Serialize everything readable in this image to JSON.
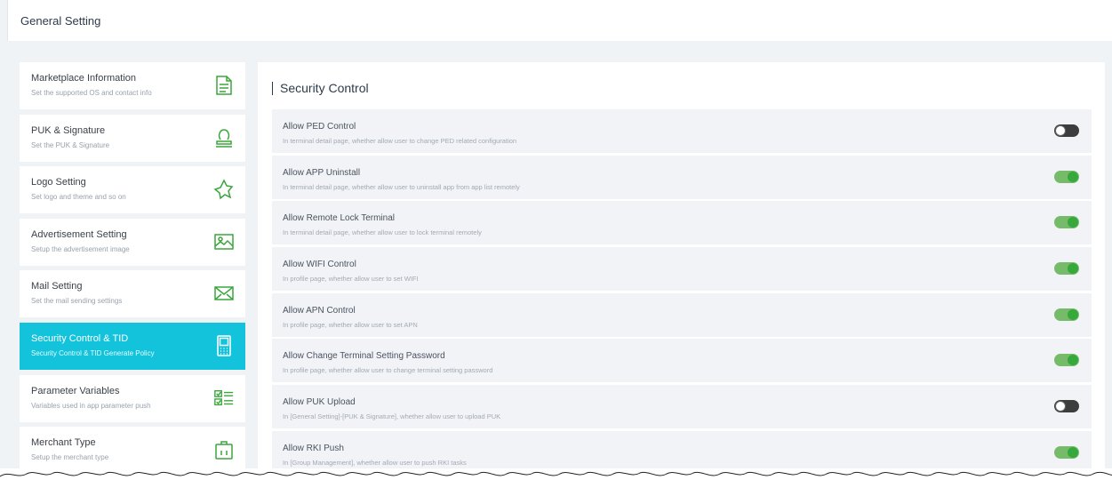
{
  "header": {
    "title": "General Setting"
  },
  "sidebar": {
    "items": [
      {
        "label": "Marketplace Information",
        "desc": "Set the supported OS and contact info",
        "icon": "document-icon"
      },
      {
        "label": "PUK & Signature",
        "desc": "Set the PUK & Signature",
        "icon": "stamp-icon"
      },
      {
        "label": "Logo Setting",
        "desc": "Set logo and theme and so on",
        "icon": "star-badge-icon"
      },
      {
        "label": "Advertisement Setting",
        "desc": "Setup the advertisement image",
        "icon": "image-icon"
      },
      {
        "label": "Mail Setting",
        "desc": "Set the mail sending settings",
        "icon": "mail-icon"
      },
      {
        "label": "Security Control & TID",
        "desc": "Security Control & TID Generate Policy",
        "icon": "terminal-icon",
        "active": true
      },
      {
        "label": "Parameter Variables",
        "desc": "Variables used in app parameter push",
        "icon": "checklist-icon"
      },
      {
        "label": "Merchant Type",
        "desc": "Setup the merchant type",
        "icon": "briefcase-icon"
      }
    ]
  },
  "main": {
    "section_title": "Security Control",
    "rows": [
      {
        "label": "Allow PED Control",
        "desc": "In terminal detail page, whether allow user to change PED related configuration",
        "enabled": false
      },
      {
        "label": "Allow APP Uninstall",
        "desc": "In terminal detail page, whether allow user to uninstall app from app list remotely",
        "enabled": true
      },
      {
        "label": "Allow Remote Lock Terminal",
        "desc": "In terminal detail page, whether allow user to lock terminal remotely",
        "enabled": true
      },
      {
        "label": "Allow WIFI Control",
        "desc": "In profile page, whether allow user to set WIFI",
        "enabled": true
      },
      {
        "label": "Allow APN Control",
        "desc": "In profile page, whether allow user to set APN",
        "enabled": true
      },
      {
        "label": "Allow Change Terminal Setting Password",
        "desc": "In profile page, whether allow user to change terminal setting password",
        "enabled": true
      },
      {
        "label": "Allow PUK Upload",
        "desc": "In [General Setting]-[PUK & Signature], whether allow user to upload PUK",
        "enabled": false
      },
      {
        "label": "Allow RKI Push",
        "desc": "In [Group Management], whether allow user to push RKI tasks",
        "enabled": true
      }
    ]
  },
  "colors": {
    "accent": "#12c3db",
    "toggle_on": "#76bb6a",
    "toggle_off": "#3d3d3d",
    "icon_green": "#3aa63c"
  }
}
